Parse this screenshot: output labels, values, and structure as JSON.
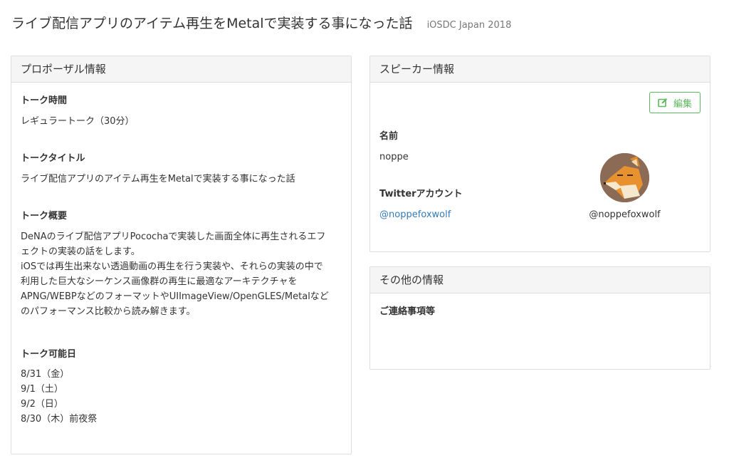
{
  "header": {
    "title": "ライブ配信アプリのアイテム再生をMetalで実装する事になった話",
    "event": "iOSDC Japan 2018"
  },
  "proposal": {
    "heading": "プロポーザル情報",
    "talk_time_label": "トーク時間",
    "talk_time_value": "レギュラートーク（30分）",
    "talk_title_label": "トークタイトル",
    "talk_title_value": "ライブ配信アプリのアイテム再生をMetalで実装する事になった話",
    "summary_label": "トーク概要",
    "summary_lines": [
      "DeNAのライブ配信アプリPocochaで実装した画面全体に再生されるエフ",
      "ェクトの実装の話をします。",
      "iOSでは再生出来ない透過動画の再生を行う実装や、それらの実装の中で",
      "利用した巨大なシーケンス画像群の再生に最適なアーキテクチャを",
      "APNG/WEBPなどのフォーマットやUIImageView/OpenGLES/Metalなど",
      "のパフォーマンス比較から読み解きます。"
    ],
    "available_label": "トーク可能日",
    "available_dates": [
      "8/31（金）",
      "9/1（土）",
      "9/2（日）",
      "8/30（木）前夜祭"
    ]
  },
  "speaker": {
    "heading": "スピーカー情報",
    "edit_label": "編集",
    "edit_icon": "edit-icon",
    "name_label": "名前",
    "name_value": "noppe",
    "twitter_label": "Twitterアカウント",
    "twitter_value": "@noppefoxwolf",
    "avatar_handle": "@noppefoxwolf"
  },
  "other": {
    "heading": "その他の情報",
    "contact_label": "ご連絡事項等"
  },
  "colors": {
    "link": "#337ab7",
    "success": "#5cb85c",
    "panel_heading_bg": "#f5f5f5",
    "border": "#dddddd"
  }
}
